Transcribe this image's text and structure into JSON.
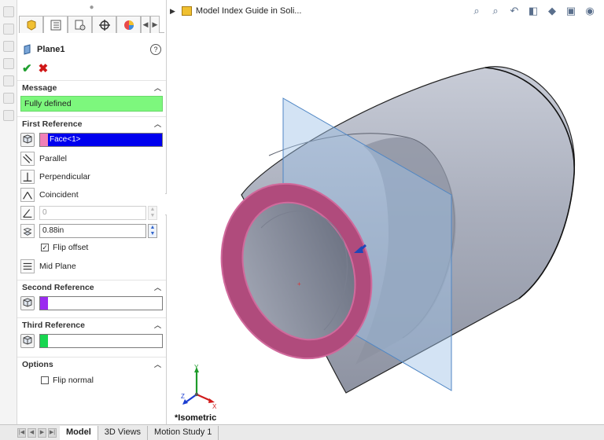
{
  "document": {
    "title": "Model Index Guide in Soli..."
  },
  "property_manager": {
    "title": "Plane1",
    "help_glyph": "?",
    "tabs": [
      "feature-manager",
      "property-manager",
      "configuration-manager",
      "dim-xpert-manager",
      "display-manager"
    ],
    "message": {
      "header": "Message",
      "text": "Fully defined",
      "color": "#7df77d"
    },
    "first_reference": {
      "header": "First Reference",
      "selection": "Face<1>",
      "swatch_color": "#f080b8",
      "highlight_color": "#0000ee",
      "options": {
        "parallel": "Parallel",
        "perpendicular": "Perpendicular",
        "coincident": "Coincident"
      },
      "angle_value": "0",
      "offset_value": "0.88in",
      "flip_offset_label": "Flip offset",
      "flip_offset_checked": true,
      "mid_plane": "Mid Plane"
    },
    "second_reference": {
      "header": "Second Reference",
      "selection": "",
      "swatch_color": "#9b2bf0"
    },
    "third_reference": {
      "header": "Third Reference",
      "selection": "",
      "swatch_color": "#18d650"
    },
    "options": {
      "header": "Options",
      "flip_normal_label": "Flip normal",
      "flip_normal_checked": false
    }
  },
  "viewport": {
    "view_label": "*Isometric",
    "triad_labels": {
      "x": "X",
      "y": "Y",
      "z": "Z"
    },
    "colors": {
      "part_body": "#b7bcc9",
      "selected_face": "#b04b7c",
      "plane": "#9ec2e6"
    }
  },
  "bottom_tabs": [
    {
      "label": "Model",
      "active": true
    },
    {
      "label": "3D Views",
      "active": false
    },
    {
      "label": "Motion Study 1",
      "active": false
    }
  ]
}
